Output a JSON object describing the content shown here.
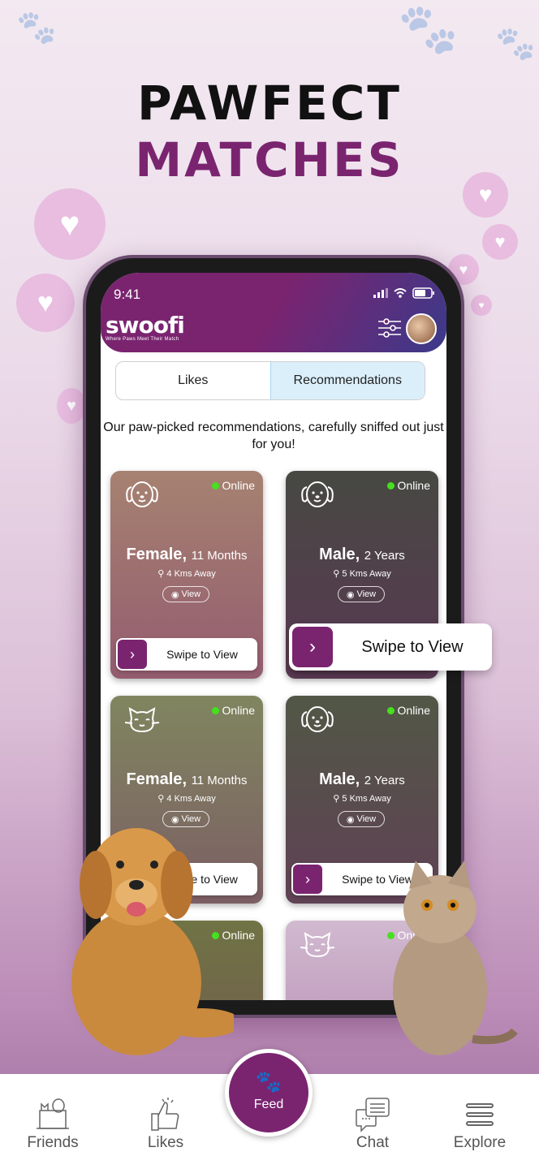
{
  "headline": {
    "line1": "PAWFECT",
    "line2": "MATCHES"
  },
  "status_bar": {
    "time": "9:41"
  },
  "app": {
    "name": "swoofi",
    "tagline": "Where Paws Meet Their Match"
  },
  "tabs": [
    {
      "label": "Likes",
      "active": false
    },
    {
      "label": "Recommendations",
      "active": true
    }
  ],
  "subtitle": "Our paw-picked recommendations, carefully sniffed out just for you!",
  "cards": [
    {
      "species": "dog",
      "gender": "Female",
      "age": "11 Months",
      "distance": "4 Kms Away",
      "status": "Online",
      "view_label": "View",
      "swipe_label": "Swipe to View",
      "bg": "#a88a6e"
    },
    {
      "species": "dog",
      "gender": "Male",
      "age": "2 Years",
      "distance": "5 Kms Away",
      "status": "Online",
      "view_label": "View",
      "swipe_label": "Swipe to View",
      "bg": "#3e4a3a"
    },
    {
      "species": "cat",
      "gender": "Female",
      "age": "11 Months",
      "distance": "4 Kms Away",
      "status": "Online",
      "view_label": "View",
      "swipe_label": "Swipe to View",
      "bg": "#7d8e5a"
    },
    {
      "species": "dog",
      "gender": "Male",
      "age": "2 Years",
      "distance": "5 Kms Away",
      "status": "Online",
      "view_label": "View",
      "swipe_label": "Swipe to View",
      "bg": "#4a5a3e"
    },
    {
      "species": "dog",
      "status": "Online",
      "bg": "#6c7a3c"
    },
    {
      "species": "cat",
      "status": "Online",
      "bg": "#d8c8d8"
    }
  ],
  "floating_swipe": {
    "label": "Swipe to View"
  },
  "nav": {
    "items": [
      {
        "label": "Friends"
      },
      {
        "label": "Likes"
      },
      {
        "label": "Feed",
        "active": true
      },
      {
        "label": "Chat"
      },
      {
        "label": "Explore"
      }
    ]
  },
  "colors": {
    "brand": "#7a2470",
    "online": "#45e01e",
    "tab_active": "#dbeffb"
  }
}
